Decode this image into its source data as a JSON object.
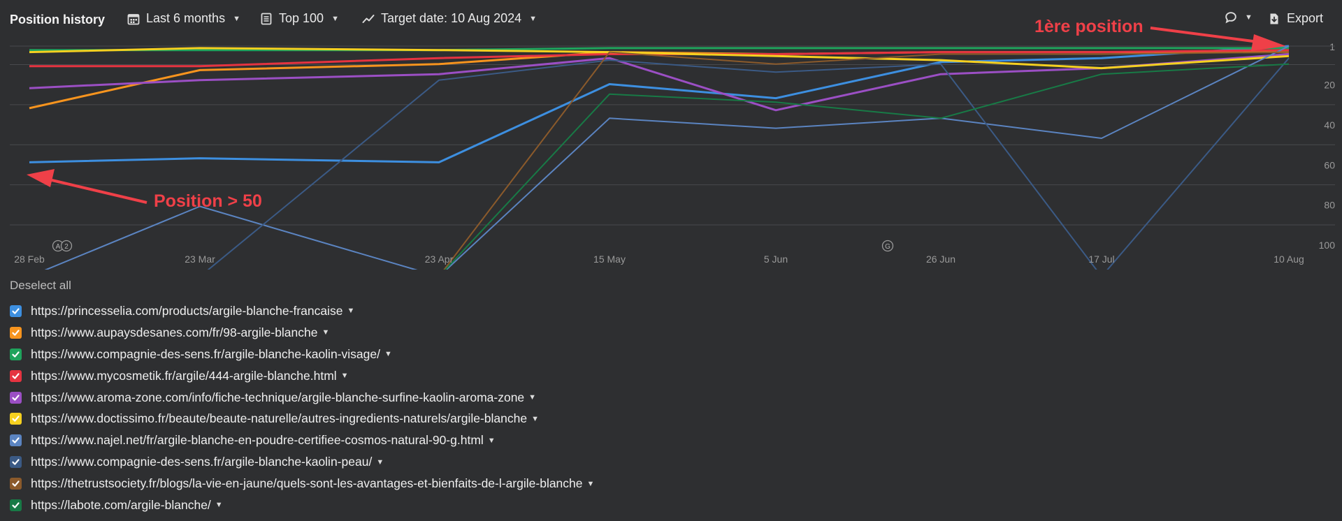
{
  "toolbar": {
    "title": "Position history",
    "period": "Last 6 months",
    "top": "Top 100",
    "target_date": "Target date: 10 Aug 2024",
    "export": "Export"
  },
  "annotations": {
    "first_position": "1ère position",
    "position_gt_50": "Position > 50"
  },
  "deselect_all": "Deselect all",
  "markers": {
    "a": "A",
    "b": "2",
    "g": "G"
  },
  "colors": {
    "background": "#2e2f31",
    "annotation": "#ef4048"
  },
  "chart_data": {
    "type": "line",
    "x_ticks": [
      "28 Feb",
      "23 Mar",
      "23 Apr",
      "15 May",
      "5 Jun",
      "26 Jun",
      "17 Jul",
      "10 Aug"
    ],
    "y_ticks": [
      "1",
      "20",
      "40",
      "60",
      "80",
      "100"
    ],
    "y_range": [
      1,
      100
    ],
    "y_inverted": true,
    "grid": true,
    "series": [
      {
        "name": "https://princesselia.com/products/argile-blanche-francaise",
        "color": "#3d8fe0",
        "width": 3,
        "points": [
          [
            "28 Feb",
            59
          ],
          [
            "23 Mar",
            57
          ],
          [
            "23 Apr",
            59
          ],
          [
            "15 May",
            20
          ],
          [
            "5 Jun",
            27
          ],
          [
            "26 Jun",
            9
          ],
          [
            "17 Jul",
            7
          ],
          [
            "10 Aug",
            1
          ]
        ]
      },
      {
        "name": "https://www.aupaysdesanes.com/fr/98-argile-blanche",
        "color": "#f7941e",
        "width": 3,
        "points": [
          [
            "28 Feb",
            32
          ],
          [
            "23 Mar",
            13
          ],
          [
            "23 Apr",
            10
          ],
          [
            "15 May",
            4
          ],
          [
            "5 Jun",
            5
          ],
          [
            "26 Jun",
            4
          ],
          [
            "17 Jul",
            4
          ],
          [
            "10 Aug",
            4
          ]
        ]
      },
      {
        "name": "https://www.compagnie-des-sens.fr/argile-blanche-kaolin-visage/",
        "color": "#1fa35c",
        "width": 3,
        "points": [
          [
            "28 Feb",
            3
          ],
          [
            "23 Mar",
            3
          ],
          [
            "23 Apr",
            3
          ],
          [
            "15 May",
            2
          ],
          [
            "5 Jun",
            2
          ],
          [
            "26 Jun",
            2
          ],
          [
            "17 Jul",
            2
          ],
          [
            "10 Aug",
            2
          ]
        ]
      },
      {
        "name": "https://www.mycosmetik.fr/argile/444-argile-blanche.html",
        "color": "#e53340",
        "width": 3,
        "points": [
          [
            "28 Feb",
            11
          ],
          [
            "23 Mar",
            11
          ],
          [
            "23 Apr",
            7
          ],
          [
            "15 May",
            5
          ],
          [
            "5 Jun",
            5
          ],
          [
            "26 Jun",
            4
          ],
          [
            "17 Jul",
            4
          ],
          [
            "10 Aug",
            3
          ]
        ]
      },
      {
        "name": "https://www.aroma-zone.com/info/fiche-technique/argile-blanche-surfine-kaolin-aroma-zone",
        "color": "#9b4fc4",
        "width": 3,
        "points": [
          [
            "28 Feb",
            22
          ],
          [
            "23 Mar",
            18
          ],
          [
            "23 Apr",
            15
          ],
          [
            "15 May",
            7
          ],
          [
            "5 Jun",
            33
          ],
          [
            "26 Jun",
            15
          ],
          [
            "17 Jul",
            12
          ],
          [
            "10 Aug",
            5
          ]
        ]
      },
      {
        "name": "https://www.doctissimo.fr/beaute/beaute-naturelle/autres-ingredients-naturels/argile-blanche",
        "color": "#f5d020",
        "width": 3,
        "points": [
          [
            "28 Feb",
            4
          ],
          [
            "23 Mar",
            2
          ],
          [
            "23 Apr",
            3
          ],
          [
            "15 May",
            4
          ],
          [
            "5 Jun",
            6
          ],
          [
            "26 Jun",
            8
          ],
          [
            "17 Jul",
            12
          ],
          [
            "10 Aug",
            6
          ]
        ]
      },
      {
        "name": "https://www.najel.net/fr/argile-blanche-en-poudre-certifiee-cosmos-natural-90-g.html",
        "color": "#5b84c1",
        "width": 2,
        "points": [
          [
            "28 Feb",
            null
          ],
          [
            "23 Mar",
            81
          ],
          [
            "23 Apr",
            null
          ],
          [
            "15 May",
            37
          ],
          [
            "5 Jun",
            42
          ],
          [
            "26 Jun",
            37
          ],
          [
            "17 Jul",
            47
          ],
          [
            "10 Aug",
            1
          ]
        ]
      },
      {
        "name": "https://www.compagnie-des-sens.fr/argile-blanche-kaolin-peau/",
        "color": "#3b5a85",
        "width": 2,
        "points": [
          [
            "28 Feb",
            null
          ],
          [
            "23 Mar",
            null
          ],
          [
            "23 Apr",
            18
          ],
          [
            "15 May",
            8
          ],
          [
            "5 Jun",
            14
          ],
          [
            "26 Jun",
            10
          ],
          [
            "17 Jul",
            null
          ],
          [
            "10 Aug",
            7
          ]
        ]
      },
      {
        "name": "https://thetrustsociety.fr/blogs/la-vie-en-jaune/quels-sont-les-avantages-et-bienfaits-de-l-argile-blanche",
        "color": "#8b5a2b",
        "width": 2,
        "points": [
          [
            "28 Feb",
            null
          ],
          [
            "23 Mar",
            null
          ],
          [
            "23 Apr",
            null
          ],
          [
            "15 May",
            4
          ],
          [
            "5 Jun",
            10
          ],
          [
            "26 Jun",
            5
          ],
          [
            "17 Jul",
            5
          ],
          [
            "10 Aug",
            4
          ]
        ]
      },
      {
        "name": "https://labote.com/argile-blanche/",
        "color": "#187a46",
        "width": 2,
        "points": [
          [
            "28 Feb",
            null
          ],
          [
            "23 Mar",
            null
          ],
          [
            "23 Apr",
            null
          ],
          [
            "15 May",
            25
          ],
          [
            "5 Jun",
            29
          ],
          [
            "26 Jun",
            37
          ],
          [
            "17 Jul",
            15
          ],
          [
            "10 Aug",
            10
          ]
        ]
      }
    ]
  }
}
